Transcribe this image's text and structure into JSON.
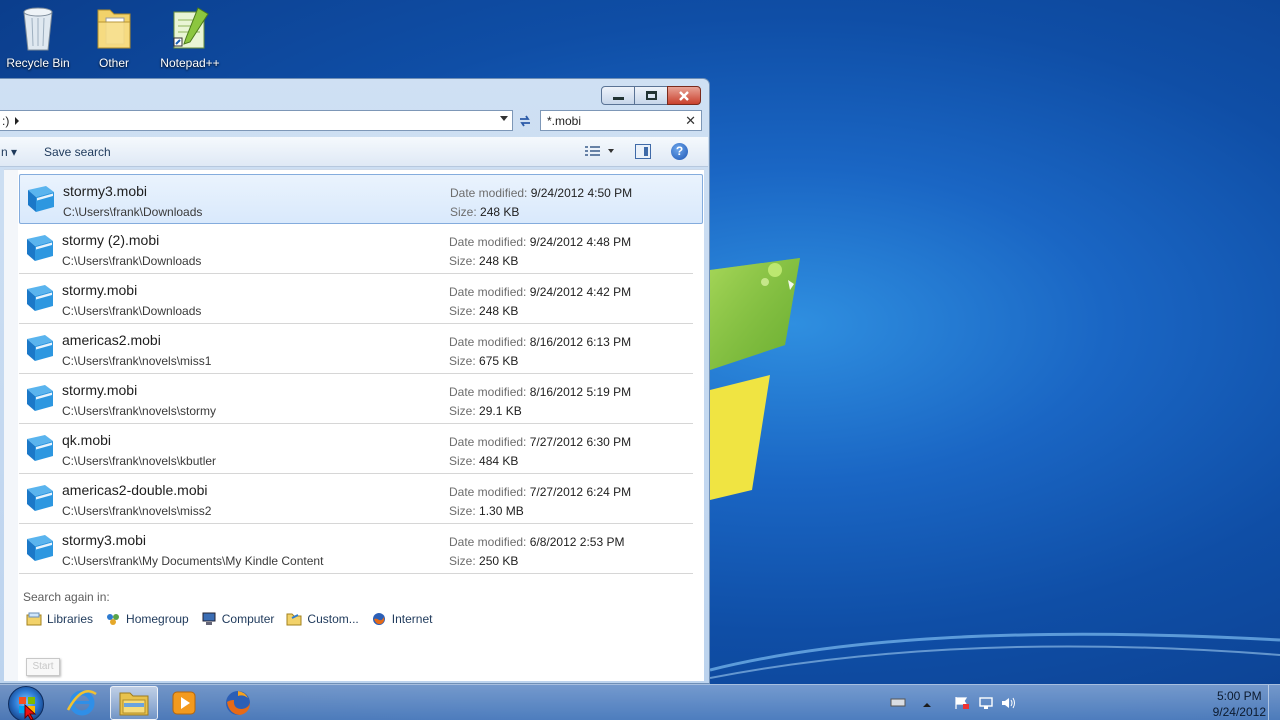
{
  "desktop": {
    "icons": [
      {
        "label": "Recycle Bin"
      },
      {
        "label": "Other"
      },
      {
        "label": "Notepad++"
      }
    ]
  },
  "window": {
    "address_fragment": ":)",
    "search_query": "*.mobi",
    "toolbar": {
      "organize_tail": "n",
      "save_search": "Save search"
    },
    "results": [
      {
        "name": "stormy3.mobi",
        "path": "C:\\Users\\frank\\Downloads",
        "date_label": "Date modified:",
        "date": "9/24/2012 4:50 PM",
        "size_label": "Size:",
        "size": "248 KB",
        "selected": true
      },
      {
        "name": "stormy (2).mobi",
        "path": "C:\\Users\\frank\\Downloads",
        "date_label": "Date modified:",
        "date": "9/24/2012 4:48 PM",
        "size_label": "Size:",
        "size": "248 KB"
      },
      {
        "name": "stormy.mobi",
        "path": "C:\\Users\\frank\\Downloads",
        "date_label": "Date modified:",
        "date": "9/24/2012 4:42 PM",
        "size_label": "Size:",
        "size": "248 KB"
      },
      {
        "name": "americas2.mobi",
        "path": "C:\\Users\\frank\\novels\\miss1",
        "date_label": "Date modified:",
        "date": "8/16/2012 6:13 PM",
        "size_label": "Size:",
        "size": "675 KB"
      },
      {
        "name": "stormy.mobi",
        "path": "C:\\Users\\frank\\novels\\stormy",
        "date_label": "Date modified:",
        "date": "8/16/2012 5:19 PM",
        "size_label": "Size:",
        "size": "29.1 KB"
      },
      {
        "name": "qk.mobi",
        "path": "C:\\Users\\frank\\novels\\kbutler",
        "date_label": "Date modified:",
        "date": "7/27/2012 6:30 PM",
        "size_label": "Size:",
        "size": "484 KB"
      },
      {
        "name": "americas2-double.mobi",
        "path": "C:\\Users\\frank\\novels\\miss2",
        "date_label": "Date modified:",
        "date": "7/27/2012 6:24 PM",
        "size_label": "Size:",
        "size": "1.30 MB"
      },
      {
        "name": "stormy3.mobi",
        "path": "C:\\Users\\frank\\My Documents\\My Kindle Content",
        "date_label": "Date modified:",
        "date": "6/8/2012 2:53 PM",
        "size_label": "Size:",
        "size": "250 KB"
      }
    ],
    "search_again": {
      "label": "Search again in:",
      "links": [
        {
          "label": "Libraries",
          "icon": "libraries-icon"
        },
        {
          "label": "Homegroup",
          "icon": "homegroup-icon"
        },
        {
          "label": "Computer",
          "icon": "computer-icon"
        },
        {
          "label": "Custom...",
          "icon": "custom-folder-icon"
        },
        {
          "label": "Internet",
          "icon": "internet-icon"
        }
      ]
    },
    "start_ghost": "Start"
  },
  "taskbar": {
    "pinned": [
      "internet-explorer-icon",
      "windows-explorer-icon",
      "media-player-icon",
      "firefox-icon"
    ],
    "clock": {
      "time": "5:00 PM",
      "date": "9/24/2012"
    }
  },
  "colors": {
    "selection": "#d9e9fc",
    "selection_border": "#84acdd",
    "link": "#1e395b",
    "desktop_blue": "#1a66c4"
  }
}
